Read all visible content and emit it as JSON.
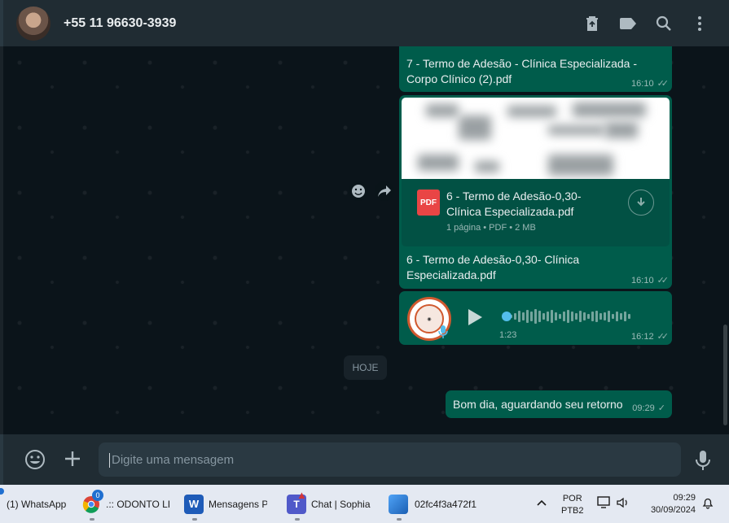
{
  "header": {
    "contact_name": "+55 11 96630-3939",
    "icons": [
      "delete-icon",
      "label-icon",
      "search-icon",
      "menu-icon"
    ]
  },
  "messages": {
    "msg7": {
      "text": "7 - Termo de Adesão - Clínica Especializada - Corpo Clínico (2).pdf",
      "time": "16:10"
    },
    "msg6": {
      "doc_icon_label": "PDF",
      "doc_title": "6 - Termo de Adesão-0,30- Clínica Especializada.pdf",
      "doc_info": "1 página • PDF • 2 MB",
      "caption": "6 - Termo de Adesão-0,30- Clínica Especializada.pdf",
      "time": "16:10"
    },
    "audio": {
      "duration": "1:23",
      "time": "16:12"
    },
    "date_chip": "HOJE",
    "last": {
      "text": "Bom dia, aguardando seu retorno",
      "time": "09:29"
    }
  },
  "footer": {
    "placeholder": "Digite uma mensagem"
  },
  "taskbar": {
    "items": [
      {
        "label": "(1) WhatsApp"
      },
      {
        "label": ".:: ODONTO LI",
        "badge": "0"
      },
      {
        "label": "Mensagens P"
      },
      {
        "label": "Chat | Sophia"
      },
      {
        "label": "02fc4f3a472f1"
      }
    ],
    "lang_top": "POR",
    "lang_bottom": "PTB2",
    "time": "09:29",
    "date": "30/09/2024"
  },
  "colors": {
    "accent": "#00a884",
    "bubble_out": "#005c4b",
    "header": "#202c33",
    "chat_bg": "#0b141a"
  }
}
